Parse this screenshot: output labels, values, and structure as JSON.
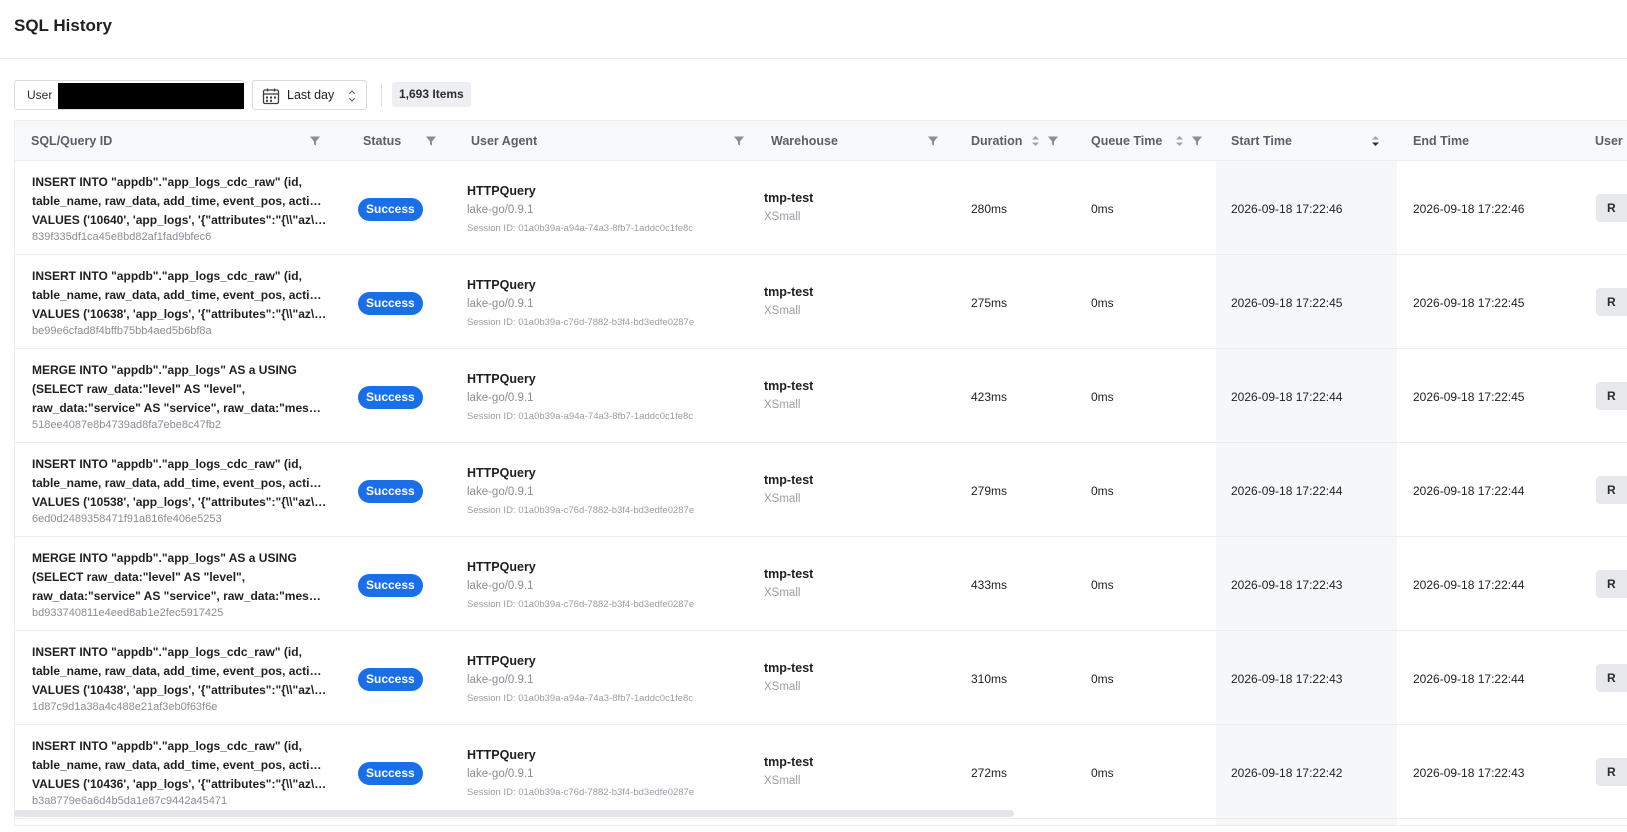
{
  "page": {
    "title": "SQL History"
  },
  "filters": {
    "user_label": "User",
    "date_range": "Last day",
    "items_count": "1,693 Items"
  },
  "columns": {
    "sql": "SQL/Query ID",
    "status": "Status",
    "user_agent": "User Agent",
    "warehouse": "Warehouse",
    "duration": "Duration",
    "queue_time": "Queue Time",
    "start_time": "Start Time",
    "end_time": "End Time",
    "user": "User"
  },
  "rows": [
    {
      "sql_lines": [
        "INSERT INTO \"appdb\".\"app_logs_cdc_raw\" (id,",
        "table_name, raw_data, add_time, event_pos, action)",
        "VALUES ('10640', 'app_logs', '{\"attributes\":\"{\\\\\"az\\\\\":..."
      ],
      "query_id": "839f335df1ca45e8bd82af1fad9bfec6",
      "status": "Success",
      "ua_name": "HTTPQuery",
      "ua_version": "lake-go/0.9.1",
      "session": "Session ID: 01a0b39a-a94a-74a3-8fb7-1addc0c1fe8c",
      "warehouse": "tmp-test",
      "warehouse_size": "XSmall",
      "duration": "280ms",
      "queue_time": "0ms",
      "start_time": "2026-09-18 17:22:46",
      "end_time": "2026-09-18 17:22:46",
      "user_initial": "R"
    },
    {
      "sql_lines": [
        "INSERT INTO \"appdb\".\"app_logs_cdc_raw\" (id,",
        "table_name, raw_data, add_time, event_pos, action)",
        "VALUES ('10638', 'app_logs', '{\"attributes\":\"{\\\\\"az\\\\\":..."
      ],
      "query_id": "be99e6cfad8f4bffb75bb4aed5b6bf8a",
      "status": "Success",
      "ua_name": "HTTPQuery",
      "ua_version": "lake-go/0.9.1",
      "session": "Session ID: 01a0b39a-c76d-7882-b3f4-bd3edfe0287e",
      "warehouse": "tmp-test",
      "warehouse_size": "XSmall",
      "duration": "275ms",
      "queue_time": "0ms",
      "start_time": "2026-09-18 17:22:45",
      "end_time": "2026-09-18 17:22:45",
      "user_initial": "R"
    },
    {
      "sql_lines": [
        "MERGE INTO \"appdb\".\"app_logs\" AS a USING",
        "(SELECT raw_data:\"level\" AS \"level\",",
        "raw_data:\"service\" AS \"service\", raw_data:\"message..."
      ],
      "query_id": "518ee4087e8b4739ad8fa7ebe8c47fb2",
      "status": "Success",
      "ua_name": "HTTPQuery",
      "ua_version": "lake-go/0.9.1",
      "session": "Session ID: 01a0b39a-a94a-74a3-8fb7-1addc0c1fe8c",
      "warehouse": "tmp-test",
      "warehouse_size": "XSmall",
      "duration": "423ms",
      "queue_time": "0ms",
      "start_time": "2026-09-18 17:22:44",
      "end_time": "2026-09-18 17:22:45",
      "user_initial": "R"
    },
    {
      "sql_lines": [
        "INSERT INTO \"appdb\".\"app_logs_cdc_raw\" (id,",
        "table_name, raw_data, add_time, event_pos, action)",
        "VALUES ('10538', 'app_logs', '{\"attributes\":\"{\\\\\"az\\\\\":..."
      ],
      "query_id": "6ed0d2489358471f91a816fe406e5253",
      "status": "Success",
      "ua_name": "HTTPQuery",
      "ua_version": "lake-go/0.9.1",
      "session": "Session ID: 01a0b39a-c76d-7882-b3f4-bd3edfe0287e",
      "warehouse": "tmp-test",
      "warehouse_size": "XSmall",
      "duration": "279ms",
      "queue_time": "0ms",
      "start_time": "2026-09-18 17:22:44",
      "end_time": "2026-09-18 17:22:44",
      "user_initial": "R"
    },
    {
      "sql_lines": [
        "MERGE INTO \"appdb\".\"app_logs\" AS a USING",
        "(SELECT raw_data:\"level\" AS \"level\",",
        "raw_data:\"service\" AS \"service\", raw_data:\"message..."
      ],
      "query_id": "bd933740811e4eed8ab1e2fec5917425",
      "status": "Success",
      "ua_name": "HTTPQuery",
      "ua_version": "lake-go/0.9.1",
      "session": "Session ID: 01a0b39a-c76d-7882-b3f4-bd3edfe0287e",
      "warehouse": "tmp-test",
      "warehouse_size": "XSmall",
      "duration": "433ms",
      "queue_time": "0ms",
      "start_time": "2026-09-18 17:22:43",
      "end_time": "2026-09-18 17:22:44",
      "user_initial": "R"
    },
    {
      "sql_lines": [
        "INSERT INTO \"appdb\".\"app_logs_cdc_raw\" (id,",
        "table_name, raw_data, add_time, event_pos, action)",
        "VALUES ('10438', 'app_logs', '{\"attributes\":\"{\\\\\"az\\\\\":..."
      ],
      "query_id": "1d87c9d1a38a4c488e21af3eb0f63f6e",
      "status": "Success",
      "ua_name": "HTTPQuery",
      "ua_version": "lake-go/0.9.1",
      "session": "Session ID: 01a0b39a-a94a-74a3-8fb7-1addc0c1fe8c",
      "warehouse": "tmp-test",
      "warehouse_size": "XSmall",
      "duration": "310ms",
      "queue_time": "0ms",
      "start_time": "2026-09-18 17:22:43",
      "end_time": "2026-09-18 17:22:44",
      "user_initial": "R"
    },
    {
      "sql_lines": [
        "INSERT INTO \"appdb\".\"app_logs_cdc_raw\" (id,",
        "table_name, raw_data, add_time, event_pos, action)",
        "VALUES ('10436', 'app_logs', '{\"attributes\":\"{\\\\\"az\\\\\":..."
      ],
      "query_id": "b3a8779e6a6d4b5da1e87c9442a45471",
      "status": "Success",
      "ua_name": "HTTPQuery",
      "ua_version": "lake-go/0.9.1",
      "session": "Session ID: 01a0b39a-c76d-7882-b3f4-bd3edfe0287e",
      "warehouse": "tmp-test",
      "warehouse_size": "XSmall",
      "duration": "272ms",
      "queue_time": "0ms",
      "start_time": "2026-09-18 17:22:42",
      "end_time": "2026-09-18 17:22:43",
      "user_initial": "R"
    }
  ],
  "colors": {
    "accent": "#1a6fe8",
    "header_bg": "#f8f9fb",
    "muted_text": "#8a8d94"
  },
  "icons": {
    "filter": "filter-icon",
    "sort": "sort-icon",
    "calendar": "calendar-icon",
    "select": "updown-icon"
  }
}
